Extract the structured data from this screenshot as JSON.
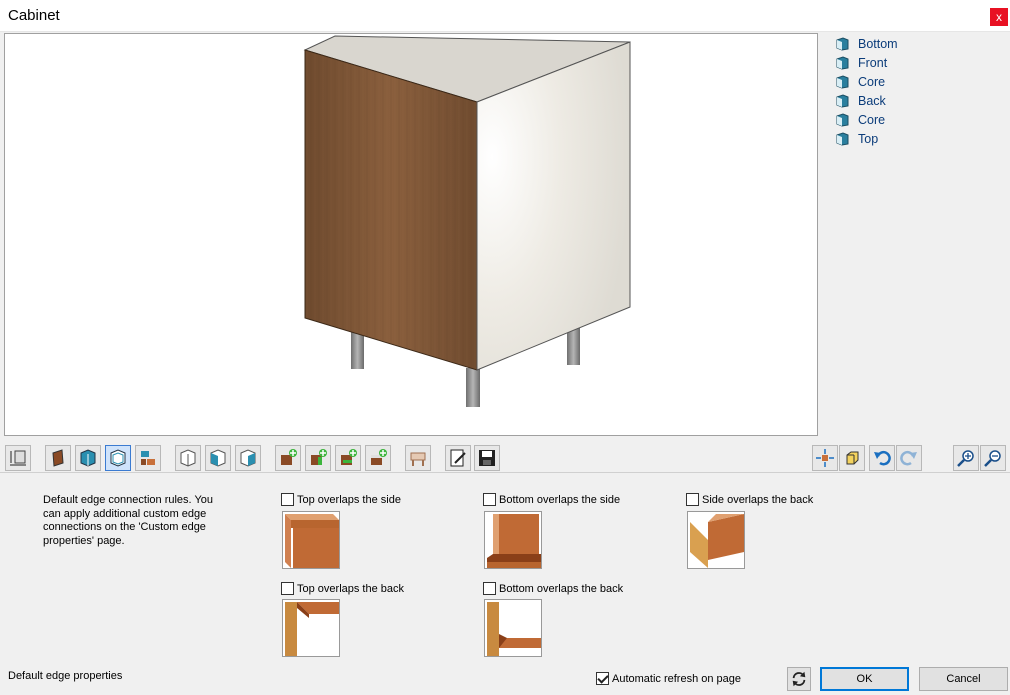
{
  "window": {
    "title": "Cabinet",
    "close_glyph": "x"
  },
  "tree": {
    "items": [
      {
        "label": "Bottom",
        "icon": "panel-icon"
      },
      {
        "label": "Front",
        "icon": "panel-icon"
      },
      {
        "label": "Core",
        "icon": "panel-icon"
      },
      {
        "label": "Back",
        "icon": "panel-icon"
      },
      {
        "label": "Core",
        "icon": "panel-icon"
      },
      {
        "label": "Top",
        "icon": "panel-icon"
      }
    ]
  },
  "toolbar": {
    "left_icons": [
      "dimensions-icon",
      "front-panel-icon",
      "side-panel-icon",
      "edge-connection-icon",
      "edge-detail-icon",
      "box-outline-icon",
      "box-front-icon",
      "box-side-icon",
      "add-front-icon",
      "add-side-icon",
      "add-back-icon",
      "add-top-icon",
      "legs-icon",
      "edit-icon",
      "save-icon"
    ],
    "right_icons": [
      "move-icon",
      "cube-view-icon",
      "undo-icon",
      "redo-icon",
      "zoom-in-icon",
      "zoom-out-icon"
    ]
  },
  "edge_rules": {
    "description": "Default edge connection rules. You can apply additional custom edge connections on the 'Custom edge properties' page.",
    "options": [
      {
        "label": "Top overlaps the side",
        "checked": false
      },
      {
        "label": "Bottom overlaps the side",
        "checked": false
      },
      {
        "label": "Side overlaps the back",
        "checked": false
      },
      {
        "label": "Top overlaps the back",
        "checked": false
      },
      {
        "label": "Bottom overlaps the back",
        "checked": false
      }
    ]
  },
  "footer": {
    "section_label": "Default edge properties",
    "auto_refresh_label": "Automatic refresh on page",
    "auto_refresh_checked": true,
    "ok_label": "OK",
    "cancel_label": "Cancel"
  },
  "colors": {
    "wood": "#7a5233",
    "white_panel": "#ece9e3",
    "edge_wood": "#c8703a",
    "accent": "#0078d7"
  }
}
